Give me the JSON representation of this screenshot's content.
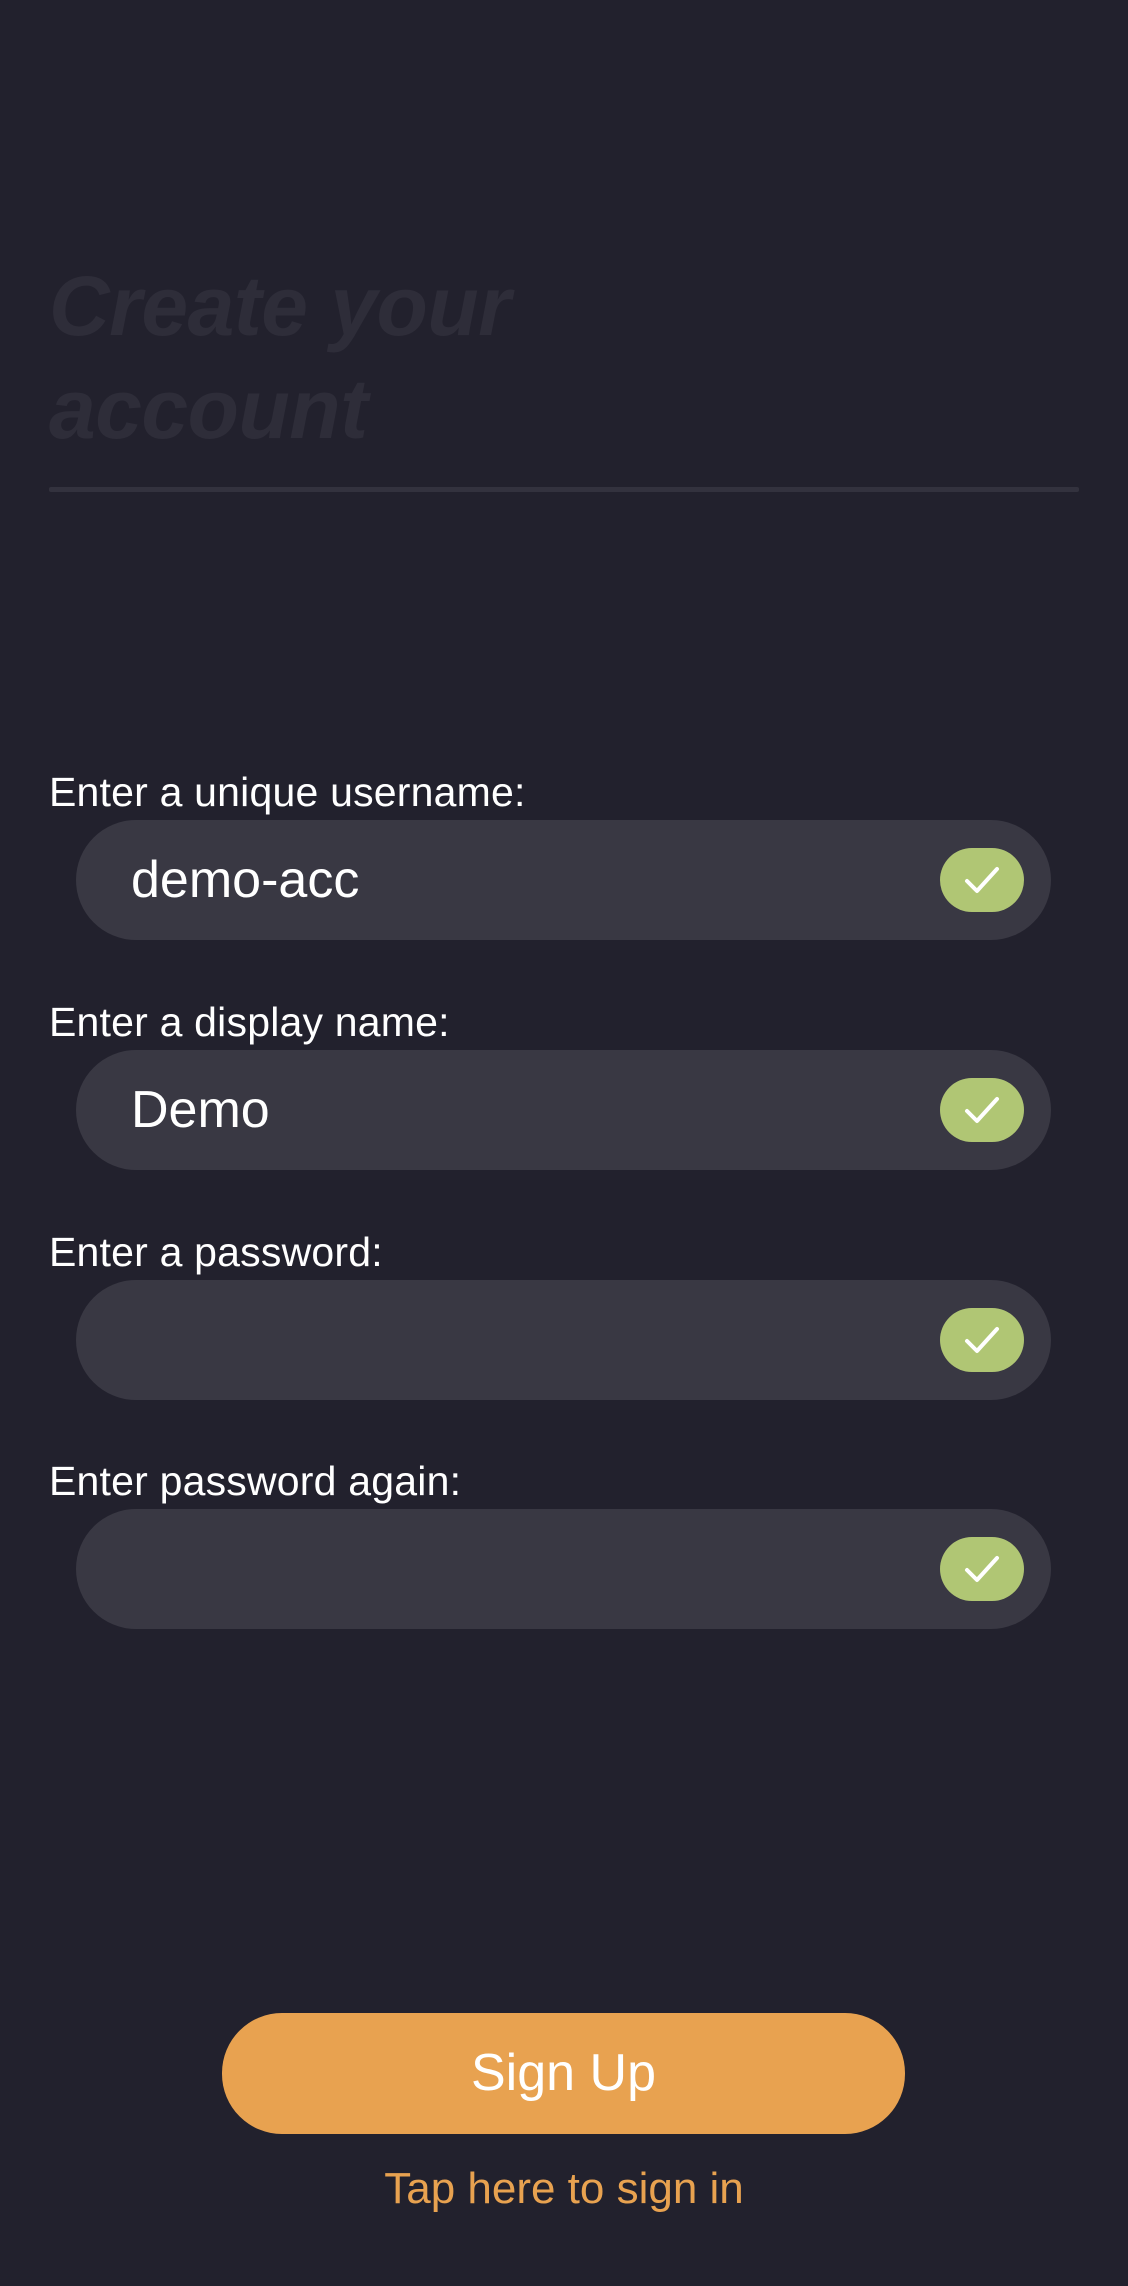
{
  "header": {
    "title": "Create your account"
  },
  "fields": [
    {
      "label": "Enter a unique username:",
      "value": "demo-acc",
      "valid": true
    },
    {
      "label": "Enter a display name:",
      "value": "Demo",
      "valid": true
    },
    {
      "label": "Enter a password:",
      "value": "",
      "valid": true
    },
    {
      "label": "Enter password again:",
      "value": "",
      "valid": true
    }
  ],
  "actions": {
    "signup_label": "Sign Up",
    "signin_link": "Tap here to sign in"
  },
  "colors": {
    "background": "#22212d",
    "field_background": "#393843",
    "accent": "#e8a250",
    "valid": "#b0c674",
    "title": "#2e2d39"
  },
  "icons": {
    "field_status": "checkmark-icon"
  }
}
